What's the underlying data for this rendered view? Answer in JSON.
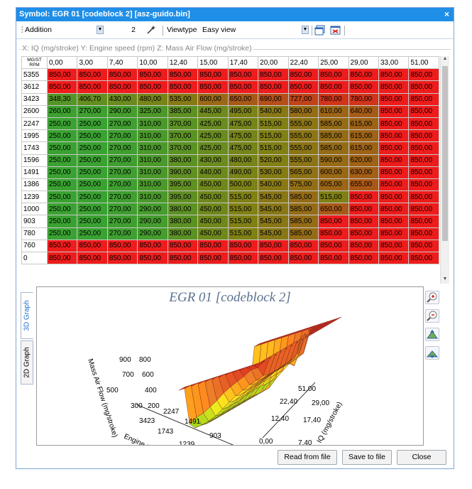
{
  "window": {
    "title": "Symbol: EGR 01 [codeblock 2] [asz-guido.bin]",
    "close_glyph": "×"
  },
  "toolbar": {
    "operation": "Addition",
    "value": "2",
    "viewtype_label": "Viewtype",
    "viewtype_value": "Easy view"
  },
  "legend": "X: IQ (mg/stroke) Y: Engine speed (rpm) Z: Mass Air Flow (mg/stroke)",
  "table": {
    "corner_top": "MG/ST",
    "corner_bottom": "RPM",
    "columns": [
      "0,00",
      "3,00",
      "7,40",
      "10,00",
      "12,40",
      "15,00",
      "17,40",
      "20,00",
      "22,40",
      "25,00",
      "29,00",
      "33,00",
      "51,00"
    ],
    "rows": [
      {
        "rpm": "5355",
        "values": [
          "850,00",
          "850,00",
          "850,00",
          "850,00",
          "850,00",
          "850,00",
          "850,00",
          "850,00",
          "850,00",
          "850,00",
          "850,00",
          "850,00",
          "850,00"
        ]
      },
      {
        "rpm": "3612",
        "values": [
          "850,00",
          "850,00",
          "850,00",
          "850,00",
          "850,00",
          "850,00",
          "850,00",
          "850,00",
          "850,00",
          "850,00",
          "850,00",
          "850,00",
          "850,00"
        ]
      },
      {
        "rpm": "3423",
        "values": [
          "348,30",
          "406,70",
          "430,00",
          "480,00",
          "535,00",
          "600,00",
          "650,00",
          "690,00",
          "727,00",
          "780,00",
          "780,00",
          "850,00",
          "850,00"
        ]
      },
      {
        "rpm": "2600",
        "values": [
          "260,00",
          "270,00",
          "290,00",
          "325,00",
          "385,00",
          "445,00",
          "495,00",
          "540,00",
          "580,00",
          "610,00",
          "640,00",
          "850,00",
          "850,00"
        ]
      },
      {
        "rpm": "2247",
        "values": [
          "250,00",
          "250,00",
          "270,00",
          "310,00",
          "370,00",
          "425,00",
          "475,00",
          "515,00",
          "555,00",
          "585,00",
          "615,00",
          "850,00",
          "850,00"
        ]
      },
      {
        "rpm": "1995",
        "values": [
          "250,00",
          "250,00",
          "270,00",
          "310,00",
          "370,00",
          "425,00",
          "475,00",
          "515,00",
          "555,00",
          "585,00",
          "615,00",
          "850,00",
          "850,00"
        ]
      },
      {
        "rpm": "1743",
        "values": [
          "250,00",
          "250,00",
          "270,00",
          "310,00",
          "370,00",
          "425,00",
          "475,00",
          "515,00",
          "555,00",
          "585,00",
          "615,00",
          "850,00",
          "850,00"
        ]
      },
      {
        "rpm": "1596",
        "values": [
          "250,00",
          "250,00",
          "270,00",
          "310,00",
          "380,00",
          "430,00",
          "480,00",
          "520,00",
          "555,00",
          "590,00",
          "620,00",
          "850,00",
          "850,00"
        ]
      },
      {
        "rpm": "1491",
        "values": [
          "250,00",
          "250,00",
          "270,00",
          "310,00",
          "390,00",
          "440,00",
          "490,00",
          "530,00",
          "565,00",
          "600,00",
          "630,00",
          "850,00",
          "850,00"
        ]
      },
      {
        "rpm": "1386",
        "values": [
          "250,00",
          "250,00",
          "270,00",
          "310,00",
          "395,00",
          "450,00",
          "500,00",
          "540,00",
          "575,00",
          "605,00",
          "655,00",
          "850,00",
          "850,00"
        ]
      },
      {
        "rpm": "1239",
        "values": [
          "250,00",
          "250,00",
          "270,00",
          "310,00",
          "395,00",
          "450,00",
          "515,00",
          "545,00",
          "585,00",
          "515,00",
          "850,00",
          "850,00",
          "850,00"
        ]
      },
      {
        "rpm": "1000",
        "values": [
          "250,00",
          "250,00",
          "270,00",
          "290,00",
          "380,00",
          "450,00",
          "515,00",
          "545,00",
          "585,00",
          "650,00",
          "850,00",
          "850,00",
          "850,00"
        ]
      },
      {
        "rpm": "903",
        "values": [
          "250,00",
          "250,00",
          "270,00",
          "290,00",
          "380,00",
          "450,00",
          "515,00",
          "545,00",
          "585,00",
          "850,00",
          "850,00",
          "850,00",
          "850,00"
        ]
      },
      {
        "rpm": "780",
        "values": [
          "250,00",
          "250,00",
          "270,00",
          "290,00",
          "380,00",
          "450,00",
          "515,00",
          "545,00",
          "585,00",
          "850,00",
          "850,00",
          "850,00",
          "850,00"
        ]
      },
      {
        "rpm": "760",
        "values": [
          "850,00",
          "850,00",
          "850,00",
          "850,00",
          "850,00",
          "850,00",
          "850,00",
          "850,00",
          "850,00",
          "850,00",
          "850,00",
          "850,00",
          "850,00"
        ]
      },
      {
        "rpm": "0",
        "values": [
          "850,00",
          "850,00",
          "850,00",
          "850,00",
          "850,00",
          "850,00",
          "850,00",
          "850,00",
          "850,00",
          "850,00",
          "850,00",
          "850,00",
          "850,00"
        ]
      }
    ],
    "cell_colors": {
      "low": "#3aa232",
      "high": "#ee1c1c"
    }
  },
  "graph": {
    "title": "EGR 01 [codeblock 2]",
    "tabs": [
      "3D Graph",
      "2D Graph"
    ],
    "z_axis_label": "Mass Air Flow (mg/stroke)",
    "z_ticks": [
      "900",
      "800",
      "700",
      "600",
      "500",
      "400",
      "300",
      "200"
    ],
    "y_axis_label": "Engine speed",
    "y_ticks": [
      "3423",
      "2247",
      "1743",
      "1491",
      "1239",
      "903"
    ],
    "x_axis_label": "IQ (mg/stroke)",
    "x_ticks": [
      "51,00",
      "22,40",
      "29,00",
      "12,40",
      "17,40",
      "0,00",
      "7,40"
    ]
  },
  "buttons": {
    "read": "Read from file",
    "save": "Save to file",
    "close": "Close"
  }
}
